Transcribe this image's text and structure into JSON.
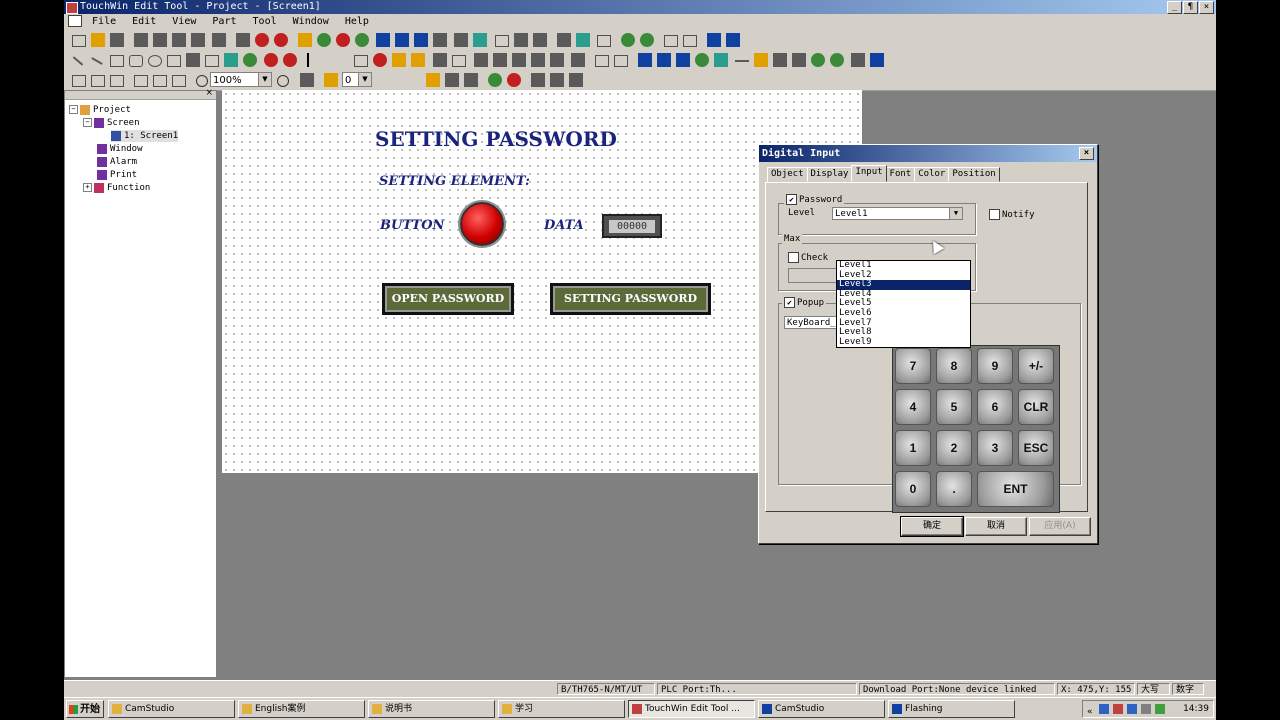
{
  "window": {
    "title": "TouchWin Edit Tool - Project - [Screen1]",
    "controls": [
      "_",
      "¶",
      "×"
    ]
  },
  "menu": [
    "File",
    "Edit",
    "View",
    "Part",
    "Tool",
    "Window",
    "Help"
  ],
  "toolbar": {
    "zoom": "100%",
    "rotate": "0"
  },
  "tree": {
    "close": "×",
    "root": "Project",
    "screen": "Screen",
    "screen1": "1: Screen1",
    "window": "Window",
    "alarm": "Alarm",
    "print": "Print",
    "function": "Function"
  },
  "canvas": {
    "title": "SETTING PASSWORD",
    "setting_element": "SETTING ELEMENT:",
    "button_label": "BUTTON",
    "data_label": "DATA",
    "data_value": "00000",
    "open_password": "OPEN PASSWORD",
    "setting_password": "SETTING PASSWORD"
  },
  "dialog": {
    "title": "Digital Input",
    "close": "×",
    "tabs": [
      "Object",
      "Display",
      "Input",
      "Font",
      "Color",
      "Position"
    ],
    "active_tab": "Input",
    "password_label": "Password",
    "password_checked": "✔",
    "level_label": "Level",
    "level_value": "Level1",
    "notify_label": "Notify",
    "max_label": "Max",
    "check_label": "Check",
    "popup_label": "Popup",
    "popup_checked": "✔",
    "keyboard_value": "KeyBoard_1",
    "levels": [
      "Level1",
      "Level2",
      "Level3",
      "Level4",
      "Level5",
      "Level6",
      "Level7",
      "Level8",
      "Level9"
    ],
    "selected_level": "Level3",
    "keys": [
      "7",
      "8",
      "9",
      "+/-",
      "4",
      "5",
      "6",
      "CLR",
      "1",
      "2",
      "3",
      "ESC",
      "0",
      ".",
      "ENT"
    ],
    "ok": "确定",
    "cancel": "取消",
    "apply": "应用(A)"
  },
  "status": {
    "model": "B/TH765-N/MT/UT",
    "plc_port": "PLC Port:Th...",
    "download_port": "Download Port:None device linked",
    "coords": "X: 475,Y: 155",
    "caps": "大写",
    "num": "数字"
  },
  "taskbar": {
    "start": "开始",
    "tasks": [
      "CamStudio",
      "English案例",
      "说明书",
      "学习",
      "TouchWin Edit Tool ...",
      "CamStudio",
      "Flashing"
    ],
    "clock": "14:39",
    "tray_expand": "«"
  }
}
